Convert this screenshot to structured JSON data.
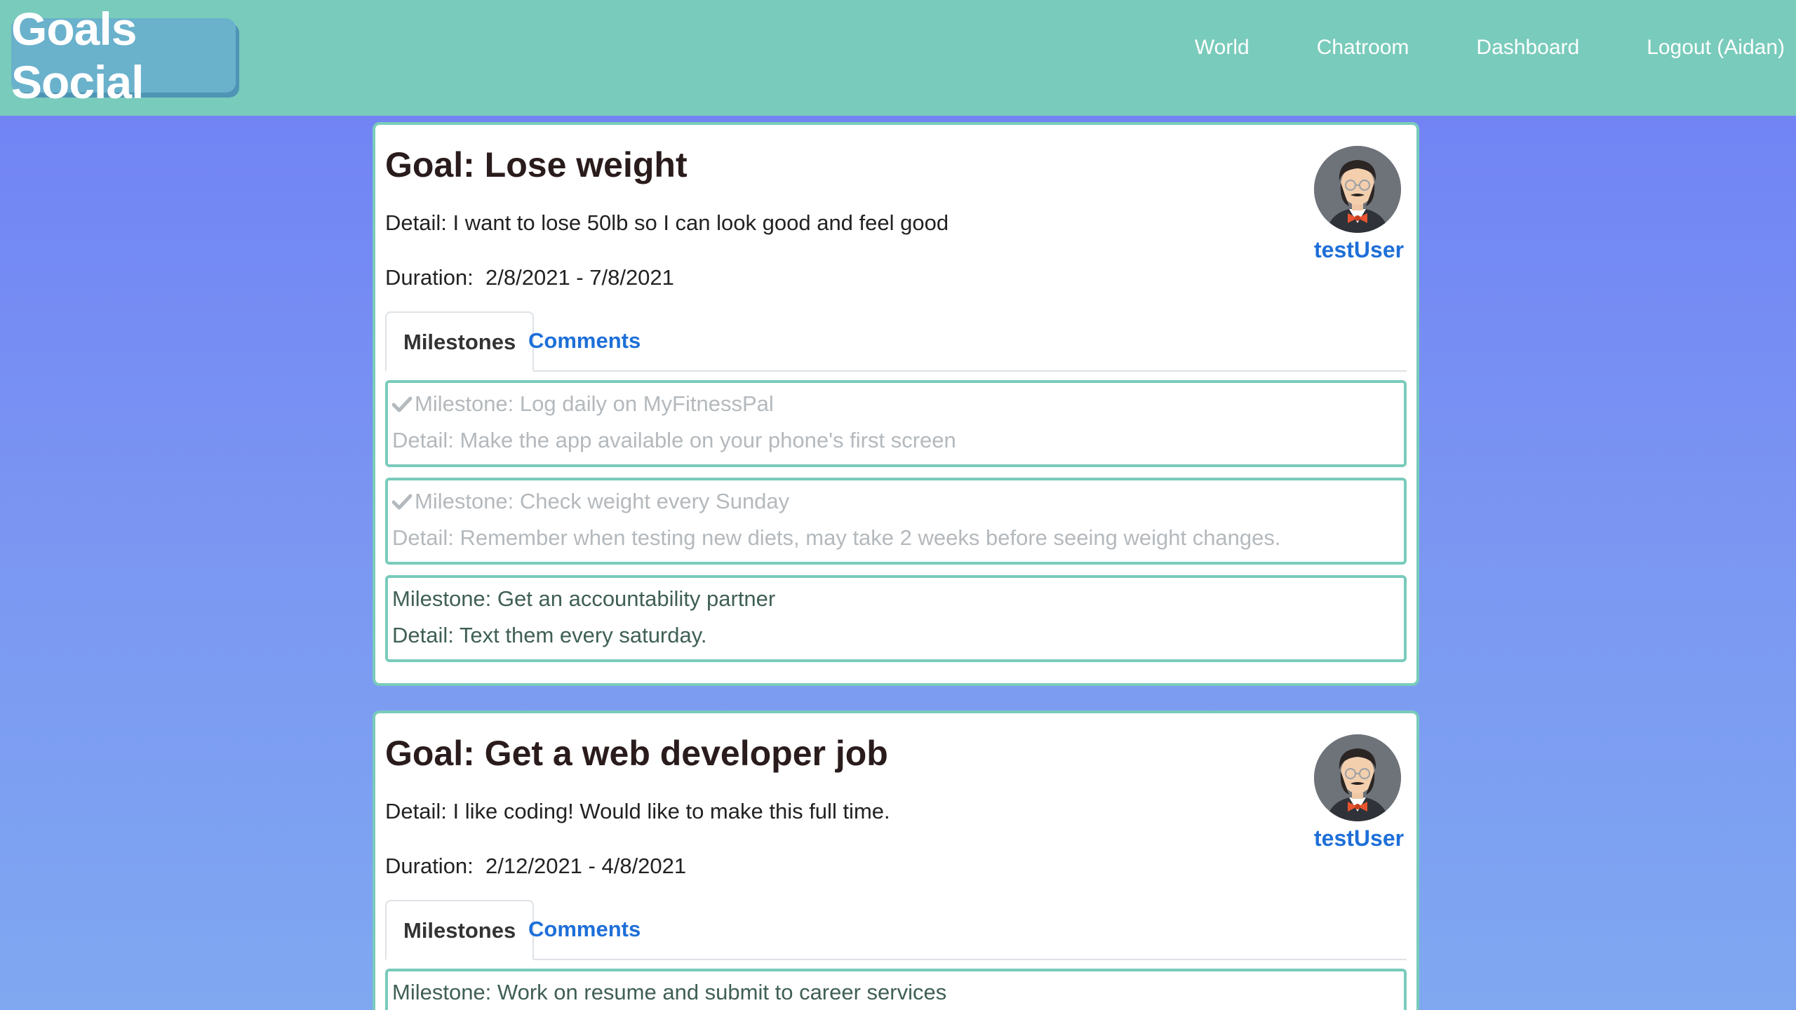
{
  "header": {
    "brand": "Goals Social",
    "nav": [
      {
        "label": "World"
      },
      {
        "label": "Chatroom"
      },
      {
        "label": "Dashboard"
      },
      {
        "label": "Logout (Aidan)"
      }
    ]
  },
  "colors": {
    "navbar": "#79cbbb",
    "brand_button": "#6ab1cc",
    "link": "#1e6fd8",
    "card_border": "#79cbbb"
  },
  "goals": [
    {
      "title": "Goal: Lose weight",
      "detail": "Detail: I want to lose 50lb so I can look good and feel good",
      "duration": "Duration:  2/8/2021 - 7/8/2021",
      "user": "testUser",
      "tabs": [
        "Milestones",
        "Comments"
      ],
      "active_tab": "Milestones",
      "milestones": [
        {
          "title": "Milestone: Log daily on MyFitnessPal",
          "detail": "Detail: Make the app available on your phone's first screen",
          "completed": true,
          "icon": "checkmark-icon"
        },
        {
          "title": "Milestone: Check weight every Sunday",
          "detail": "Detail: Remember when testing new diets, may take 2 weeks before seeing weight changes.",
          "completed": true,
          "icon": "checkmark-icon"
        },
        {
          "title": "Milestone: Get an accountability partner",
          "detail": "Detail: Text them every saturday.",
          "completed": false
        }
      ]
    },
    {
      "title": "Goal: Get a web developer job",
      "detail": "Detail: I like coding! Would like to make this full time.",
      "duration": "Duration:  2/12/2021 - 4/8/2021",
      "user": "testUser",
      "tabs": [
        "Milestones",
        "Comments"
      ],
      "active_tab": "Milestones",
      "milestones": [
        {
          "title": "Milestone: Work on resume and submit to career services",
          "completed": false
        }
      ]
    }
  ]
}
